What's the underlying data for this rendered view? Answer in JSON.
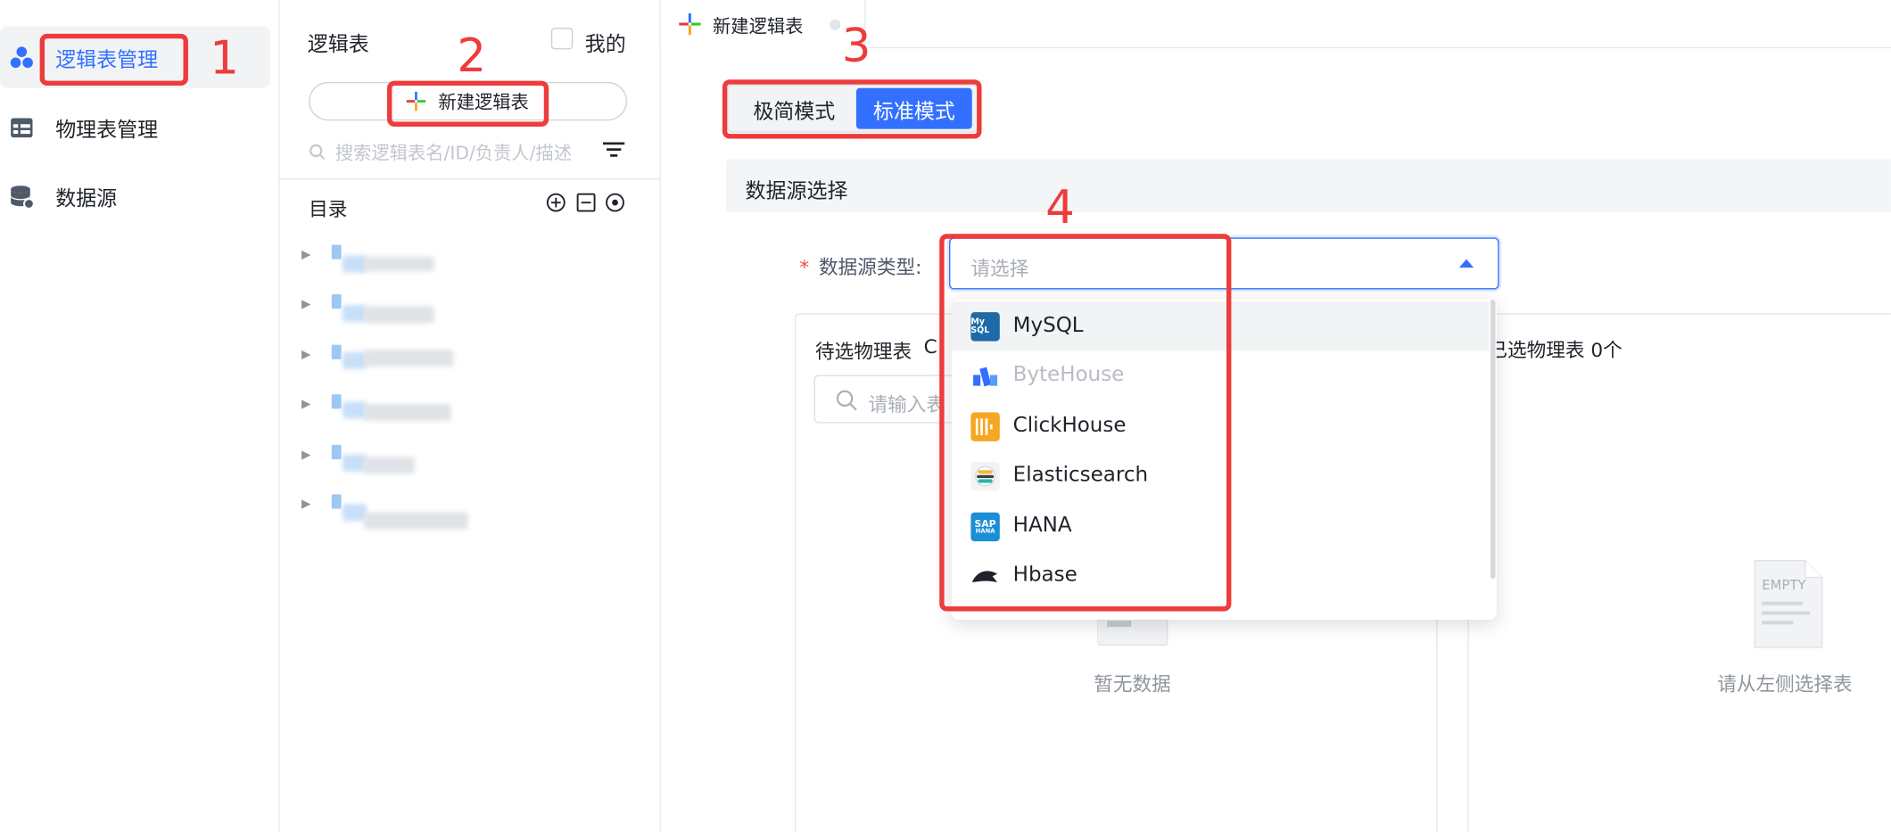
{
  "colors": {
    "accent": "#3370ff",
    "annotation": "#ee3b3b",
    "required": "#f54a45"
  },
  "sidebar": {
    "items": [
      {
        "label": "逻辑表管理",
        "icon": "cubes-icon",
        "active": true
      },
      {
        "label": "物理表管理",
        "icon": "table-icon",
        "active": false
      },
      {
        "label": "数据源",
        "icon": "database-icon",
        "active": false
      }
    ]
  },
  "middle": {
    "title": "逻辑表",
    "mine_label": "我的",
    "new_button": "新建逻辑表",
    "search_placeholder": "搜索逻辑表名/ID/负责人/描述",
    "directory_label": "目录"
  },
  "tabs": [
    {
      "label": "新建逻辑表"
    }
  ],
  "mode_toggle": {
    "simple": "极简模式",
    "standard": "标准模式",
    "selected": "standard"
  },
  "section": {
    "title": "数据源选择"
  },
  "form": {
    "datasource_type_label": "数据源类型:",
    "required_mark": "*",
    "select_placeholder": "请选择"
  },
  "transfer": {
    "left_title": "待选物理表",
    "left_refresh": "C",
    "left_search_placeholder": "请输入表",
    "left_empty": "暂无数据",
    "right_title": "已选物理表 0个",
    "right_empty": "请从左侧选择表",
    "right_empty_icon_text": "EMPTY"
  },
  "dropdown": {
    "options": [
      {
        "label": "MySQL",
        "logo": "mysql-logo",
        "disabled": false,
        "hover": true
      },
      {
        "label": "ByteHouse",
        "logo": "bytehouse-logo",
        "disabled": true,
        "hover": false
      },
      {
        "label": "ClickHouse",
        "logo": "clickhouse-logo",
        "disabled": false,
        "hover": false
      },
      {
        "label": "Elasticsearch",
        "logo": "elasticsearch-logo",
        "disabled": false,
        "hover": false
      },
      {
        "label": "HANA",
        "logo": "sap-hana-logo",
        "disabled": false,
        "hover": false
      },
      {
        "label": "Hbase",
        "logo": "hbase-logo",
        "disabled": false,
        "hover": false
      }
    ],
    "logo_texts": {
      "mysql": "My SQL",
      "sap": "SAP",
      "hana": "HANA"
    }
  },
  "annotations": [
    "1",
    "2",
    "3",
    "4"
  ]
}
